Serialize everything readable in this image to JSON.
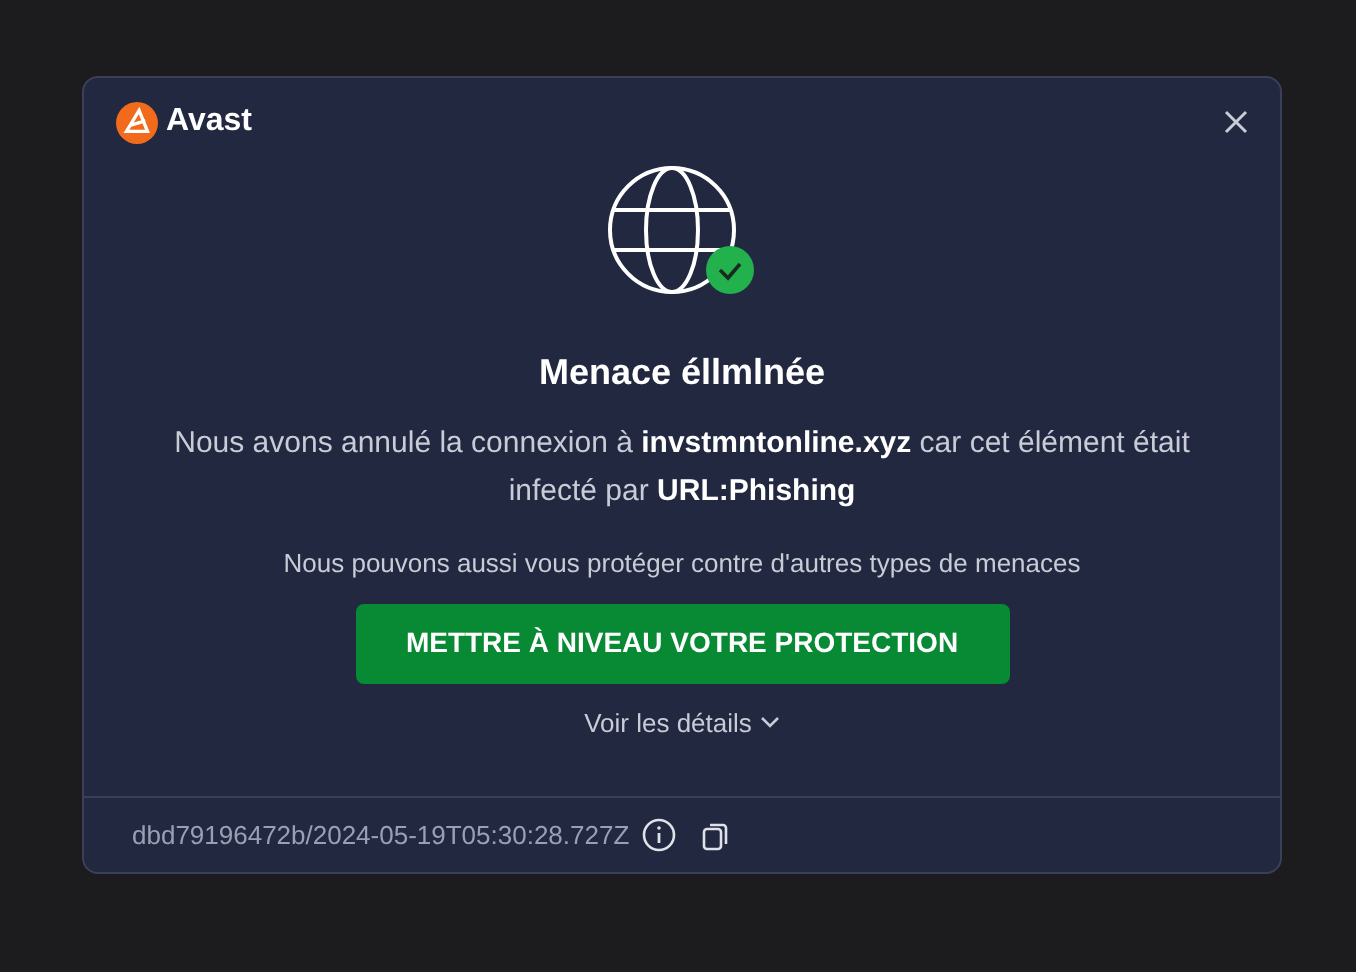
{
  "brand": {
    "name": "Avast"
  },
  "title": "Menace éllmlnée",
  "message": "Nous avons annulé la connexion à **invstmntonline.xyz** car cet élément était infecté par **URL:Phishing**",
  "upsell": "Nous pouvons aussi vous protéger contre d'autres types de menaces",
  "upgrade_button": "METTRE À NIVEAU VOTRE PROTECTION",
  "details_link": {
    "label": "Voir les détails",
    "expanded": false
  },
  "footer": {
    "id": "dbd79196472b/2024-05-19T05:30:28.727Z"
  }
}
